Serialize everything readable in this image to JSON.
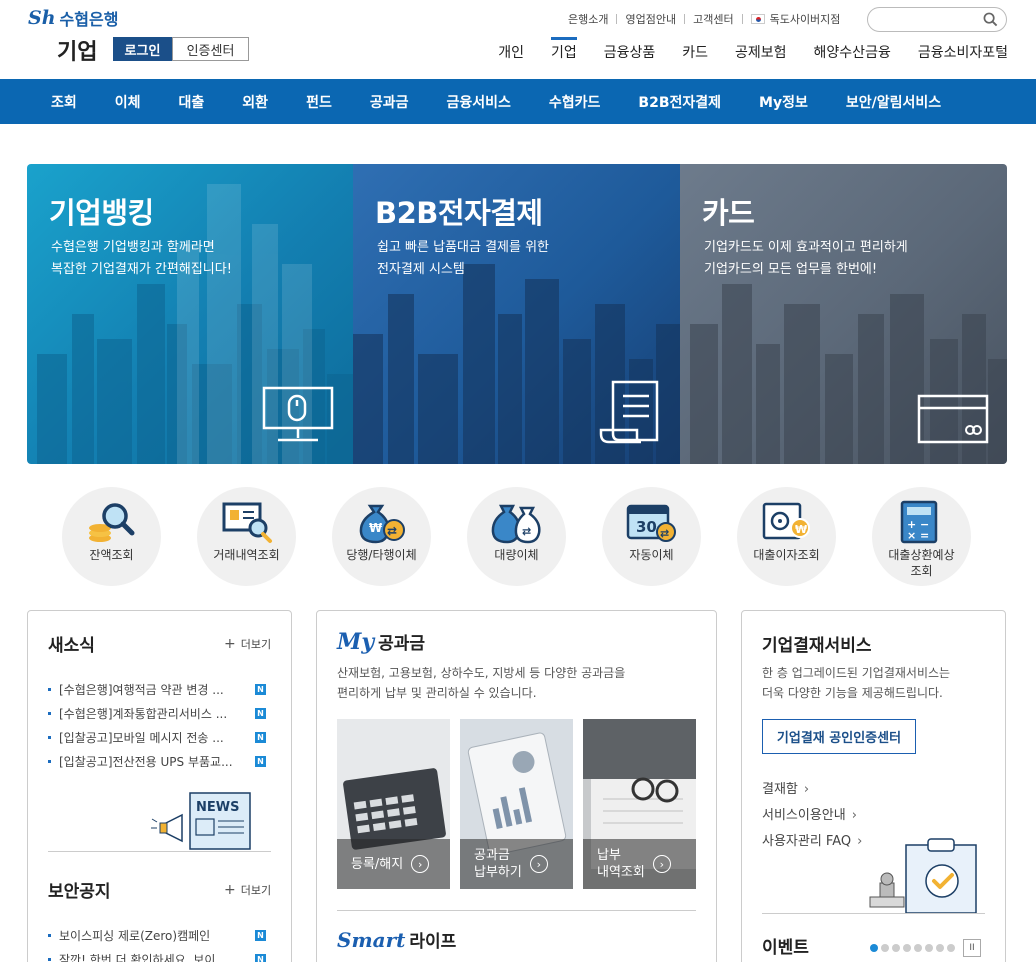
{
  "header": {
    "logo_mark": "Sh",
    "logo_name": "수협은행",
    "section": "기업",
    "login_label": "로그인",
    "cert_label": "인증센터",
    "util_links": [
      "은행소개",
      "영업점안내",
      "고객센터",
      "독도사이버지점"
    ],
    "search_placeholder": "",
    "main_nav": [
      "개인",
      "기업",
      "금융상품",
      "카드",
      "공제보험",
      "해양수산금융",
      "금융소비자포털"
    ],
    "active_nav": "기업"
  },
  "subnav": [
    "조회",
    "이체",
    "대출",
    "외환",
    "펀드",
    "공과금",
    "금융서비스",
    "수협카드",
    "B2B전자결제",
    "My정보",
    "보안/알림서비스"
  ],
  "hero": [
    {
      "title": "기업뱅킹",
      "desc1": "수협은행 기업뱅킹과 함께라면",
      "desc2": "복잡한 기업결재가 간편해집니다!",
      "icon": "monitor-mouse-icon"
    },
    {
      "title": "B2B전자결제",
      "desc1": "쉽고 빠른 납품대금 결제를 위한",
      "desc2": "전자결제 시스템",
      "icon": "receipt-icon"
    },
    {
      "title": "카드",
      "desc1": "기업카드도 이제 효과적이고 편리하게",
      "desc2": "기업카드의 모든 업무를 한번에!",
      "icon": "credit-card-icon"
    }
  ],
  "quick": [
    "잔액조회",
    "거래내역조회",
    "당행/타행이체",
    "대량이체",
    "자동이체",
    "대출이자조회",
    "대출상환예상\n조회"
  ],
  "news": {
    "title": "새소식",
    "more": "더보기",
    "items": [
      "[수협은행]여행적금 약관 변경 ...",
      "[수협은행]계좌통합관리서비스 ...",
      "[입찰공고]모바일 메시지 전송 ...",
      "[입찰공고]전산전용 UPS 부품교..."
    ],
    "badge": "N",
    "news_tag": "NEWS"
  },
  "security": {
    "title": "보안공지",
    "more": "더보기",
    "items": [
      "보이스피싱 제로(Zero)캠페인",
      "잠깐! 한번 더 확인하세요. 보이..."
    ],
    "badge": "N"
  },
  "my": {
    "italic": "My",
    "rest": "공과금",
    "desc1": "산재보험, 고용보험, 상하수도, 지방세 등 다양한 공과금을",
    "desc2": "편리하게 납부 및 관리하실 수 있습니다.",
    "tiles": [
      {
        "line1": "등록/해지",
        "line2": ""
      },
      {
        "line1": "공과금",
        "line2": "납부하기"
      },
      {
        "line1": "납부",
        "line2": "내역조회"
      }
    ]
  },
  "smart": {
    "italic": "Smart",
    "rest": "라이프"
  },
  "b2b": {
    "title": "기업결재서비스",
    "desc1": "한 층 업그레이드된 기업결재서비스는",
    "desc2": "더욱 다양한 기능을 제공해드립니다.",
    "button": "기업결재 공인인증센터",
    "links": [
      "결재함",
      "서비스이용안내",
      "사용자관리 FAQ"
    ]
  },
  "event": {
    "title": "이벤트",
    "slide_count": 8,
    "active_slide": 1,
    "pause_label": "II"
  },
  "colors": {
    "brand": "#1b4f89",
    "nav_bar": "#0b67b2",
    "accent": "#1b8ad6"
  }
}
